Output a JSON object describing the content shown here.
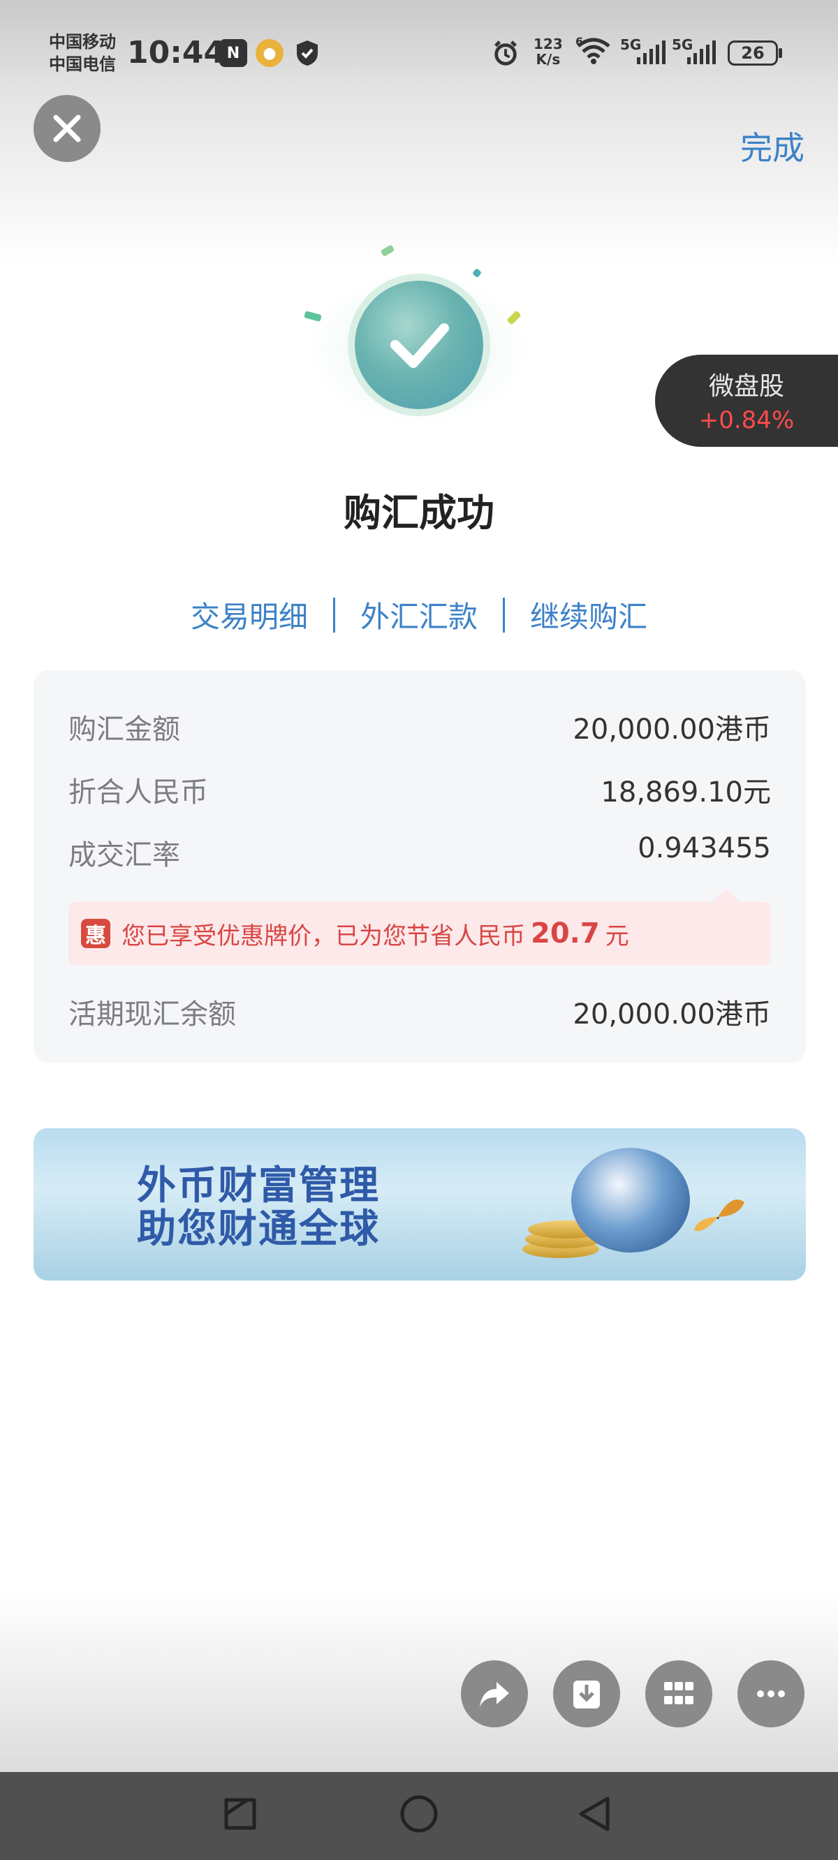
{
  "status_bar": {
    "carrier_1": "中国移动",
    "carrier_2": "中国电信",
    "time": "10:44",
    "net_speed_top": "123",
    "net_speed_bottom": "K/s",
    "wifi_label": "6",
    "signal_1": "5G",
    "signal_2": "5G",
    "battery": "26"
  },
  "header": {
    "done_label": "完成"
  },
  "floating_badge": {
    "name": "微盘股",
    "change": "+0.84%"
  },
  "result": {
    "title": "购汇成功"
  },
  "links": {
    "details": "交易明细",
    "remit": "外汇汇款",
    "continue": "继续购汇"
  },
  "details": {
    "rows": [
      {
        "label": "购汇金额",
        "value": "20,000.00港币"
      },
      {
        "label": "折合人民币",
        "value": "18,869.10元"
      },
      {
        "label": "成交汇率",
        "value": "0.943455"
      }
    ],
    "promo": {
      "icon": "惠",
      "text_prefix": "您已享受优惠牌价，已为您节省人民币",
      "amount": "20.7",
      "unit": "元"
    },
    "balance": {
      "label": "活期现汇余额",
      "value": "20,000.00港币"
    }
  },
  "banner": {
    "line1": "外币财富管理",
    "line2": "助您财通全球"
  },
  "colors": {
    "accent": "#3c82c8",
    "promo_red": "#d94545",
    "stock_up": "#ff4b4b"
  },
  "icons": [
    "close-icon",
    "checkmark-icon",
    "share-icon",
    "download-icon",
    "apps-grid-icon",
    "more-icon",
    "back-icon",
    "home-icon",
    "recents-icon"
  ]
}
